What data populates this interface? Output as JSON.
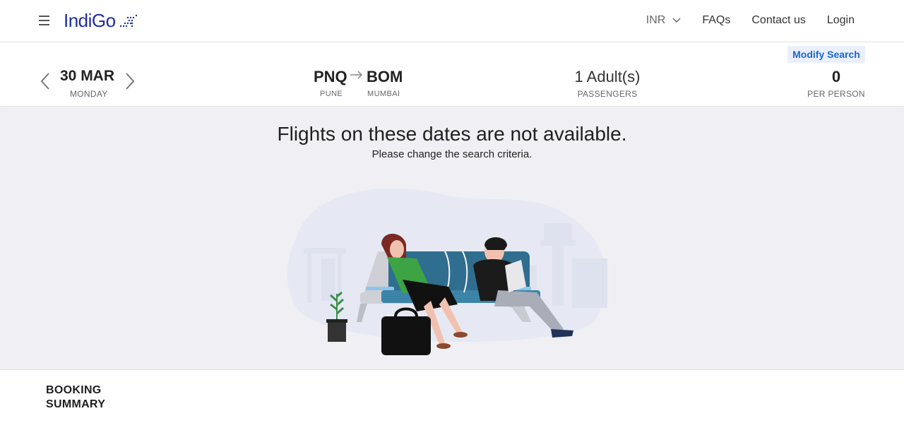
{
  "header": {
    "logo": "IndiGo",
    "currency": "INR",
    "nav": {
      "faqs": "FAQs",
      "contact": "Contact us",
      "login": "Login"
    }
  },
  "search": {
    "modify_label": "Modify Search",
    "date": {
      "main": "30 MAR",
      "day": "MONDAY"
    },
    "route": {
      "from_code": "PNQ",
      "from_city": "PUNE",
      "to_code": "BOM",
      "to_city": "MUMBAI"
    },
    "passengers": {
      "value": "1 Adult(s)",
      "label": "PASSENGERS"
    },
    "price": {
      "value": "0",
      "label": "PER PERSON"
    }
  },
  "empty_state": {
    "title": "Flights on these dates are not available.",
    "subtitle": "Please change the search criteria."
  },
  "footer": {
    "booking_summary": "BOOKING SUMMARY"
  },
  "colors": {
    "brand": "#1f2e9a",
    "accent": "#1a66d6",
    "background": "#f0f0f4"
  },
  "icons": [
    "menu-icon",
    "plane-icon",
    "chevron-down-icon",
    "chevron-left-icon",
    "chevron-right-icon",
    "arrow-right-icon"
  ]
}
